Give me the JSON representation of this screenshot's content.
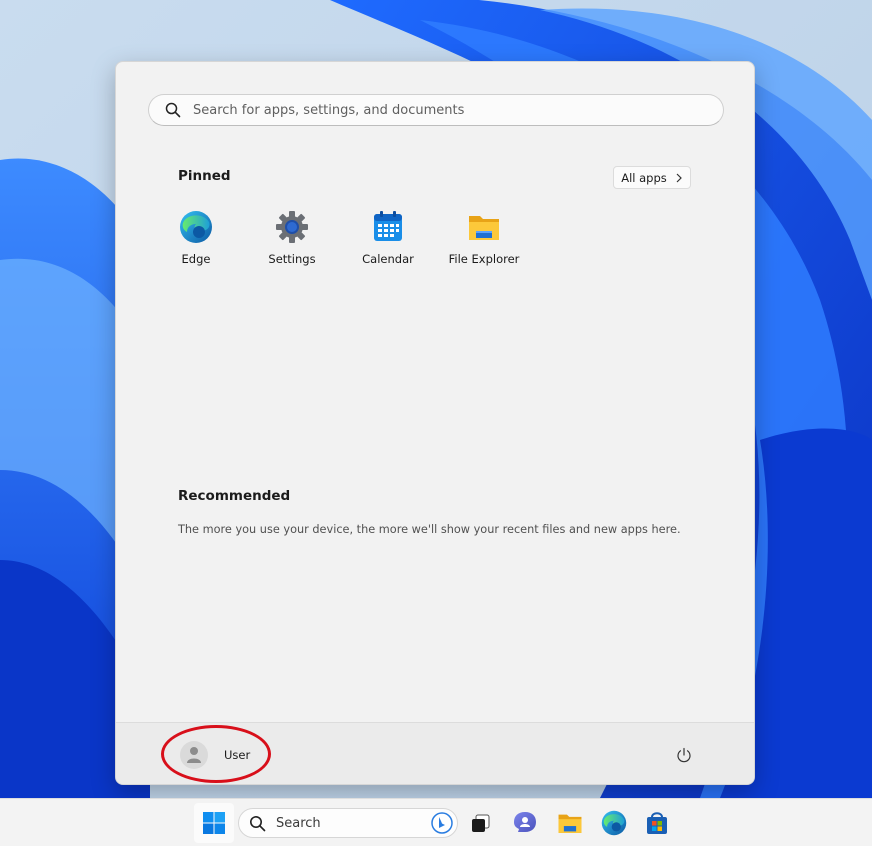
{
  "start_menu": {
    "search_placeholder": "Search for apps, settings, and documents",
    "pinned_title": "Pinned",
    "all_apps_label": "All apps",
    "pinned_apps": [
      {
        "label": "Edge",
        "icon": "edge-icon"
      },
      {
        "label": "Settings",
        "icon": "settings-gear-icon"
      },
      {
        "label": "Calendar",
        "icon": "calendar-icon"
      },
      {
        "label": "File Explorer",
        "icon": "folder-icon"
      }
    ],
    "recommended_title": "Recommended",
    "recommended_empty_text": "The more you use your device, the more we'll show your recent files and new apps here.",
    "user_name": "User"
  },
  "taskbar": {
    "search_label": "Search",
    "icons": [
      "windows-start-icon",
      "search-icon",
      "bing-icon",
      "task-view-icon",
      "chat-icon",
      "file-explorer-icon",
      "edge-icon",
      "store-icon"
    ]
  },
  "colors": {
    "accent": "#0067c0",
    "annotation": "#d80f1a",
    "menu_background": "#f2f2f2",
    "footer_background": "#ebebeb"
  }
}
